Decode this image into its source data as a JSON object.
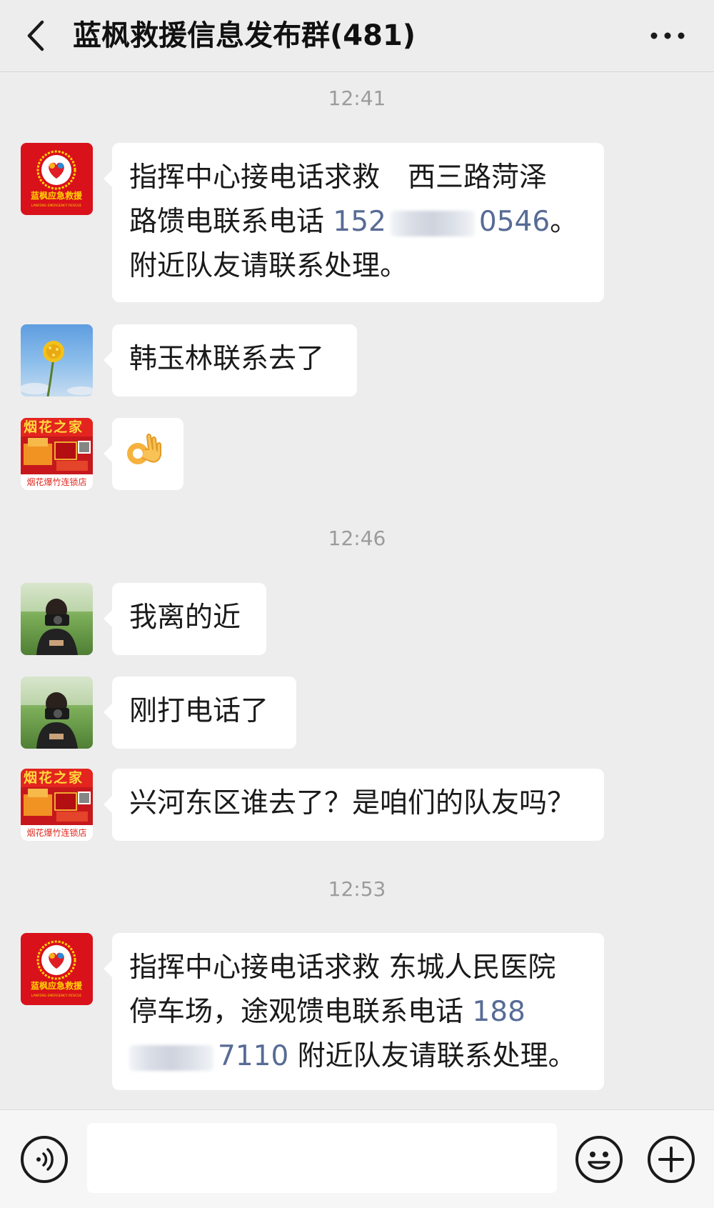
{
  "header": {
    "back_icon": "chevron-left-icon",
    "title": "蓝枫救援信息发布群(481)",
    "more_icon": "more-dots-icon"
  },
  "messages": [
    {
      "time": "12:41"
    },
    {
      "sender": "蓝枫应急救援",
      "avatar": "rescue-logo",
      "line1": "指挥中心接电话求救　西三路菏泽",
      "line2_text": "路馈电联系电话",
      "phone_a": "152",
      "phone_b": "0546",
      "line2_end": "。",
      "line3": "附近队友请联系处理。"
    },
    {
      "sender": "dandelion",
      "avatar": "dandelion-photo",
      "text": "韩玉林联系去了"
    },
    {
      "sender": "烟花之家",
      "avatar": "fireworks-logo",
      "emoji": "ok-hand-emoji"
    },
    {
      "time": "12:46"
    },
    {
      "sender": "photographer",
      "avatar": "photographer-photo",
      "text": "我离的近"
    },
    {
      "sender": "photographer",
      "avatar": "photographer-photo",
      "text": "刚打电话了"
    },
    {
      "sender": "烟花之家",
      "avatar": "fireworks-logo",
      "text": "兴河东区谁去了？是咱们的队友吗？"
    },
    {
      "time": "12:53"
    },
    {
      "sender": "蓝枫应急救援",
      "avatar": "rescue-logo",
      "line1": "指挥中心接电话求救 东城人民医院",
      "line2_text": "停车场，途观馈电联系电话",
      "phone_a": "188",
      "phone_b": "7110",
      "line3_end": "附近队友请联系处理。"
    }
  ],
  "fireworks_avatar": {
    "head": "烟花之家",
    "foot": "烟花爆竹连锁店"
  },
  "rescue_avatar": {
    "name": "蓝枫应急救援",
    "sub": "LANFENG EMERGENCY RESCUE"
  },
  "inputbar": {
    "voice_icon": "voice-icon",
    "emoji_icon": "emoji-icon",
    "plus_icon": "plus-icon",
    "value": ""
  },
  "colors": {
    "background": "#ededed",
    "bubble": "#ffffff",
    "link": "#576b95",
    "rescue_red": "#d9111b"
  }
}
